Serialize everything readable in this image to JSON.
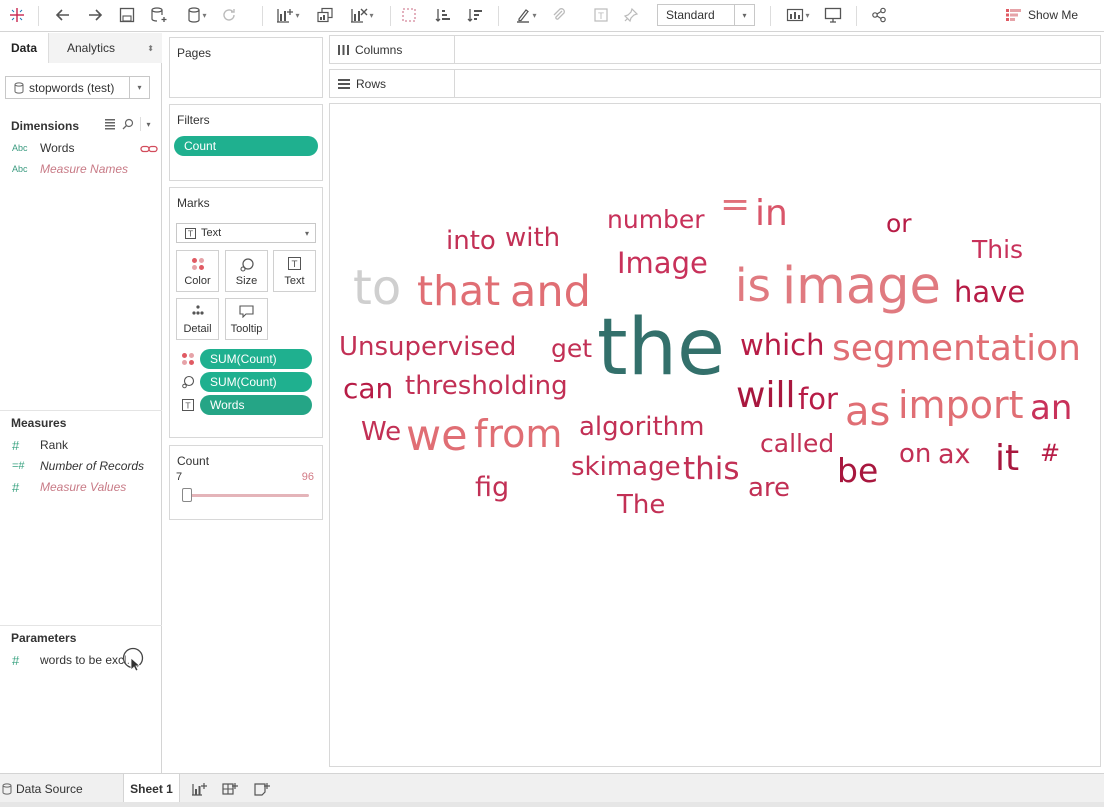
{
  "toolbar": {
    "fit_value": "Standard",
    "show_me_label": "Show Me"
  },
  "data_pane": {
    "tabs": [
      "Data",
      "Analytics"
    ],
    "data_source": "stopwords (test)",
    "dimensions_heading": "Dimensions",
    "dimensions": [
      {
        "type": "Abc",
        "label": "Words"
      },
      {
        "type": "Abc",
        "label": "Measure Names"
      }
    ],
    "measures_heading": "Measures",
    "measures": [
      {
        "type": "#",
        "label": "Rank"
      },
      {
        "type": "=#",
        "label": "Number of Records"
      },
      {
        "type": "#",
        "label": "Measure Values"
      }
    ],
    "parameters_heading": "Parameters",
    "parameters": [
      {
        "type": "#",
        "label": "words to be excl..."
      }
    ]
  },
  "pages": {
    "title": "Pages"
  },
  "filters": {
    "title": "Filters",
    "items": [
      "Count"
    ]
  },
  "marks": {
    "title": "Marks",
    "mark_type": "Text",
    "buttons": [
      "Color",
      "Size",
      "Text",
      "Detail",
      "Tooltip"
    ],
    "fields": [
      "SUM(Count)",
      "SUM(Count)",
      "Words"
    ]
  },
  "count_filter": {
    "title": "Count",
    "min": "7",
    "max": "96"
  },
  "shelves": {
    "columns": "Columns",
    "rows": "Rows"
  },
  "word_cloud": [
    {
      "text": "the",
      "color": "#33706b"
    },
    {
      "text": "to",
      "color": "#cfcfcf"
    },
    {
      "text": "that",
      "color": "#e06e74"
    },
    {
      "text": "and",
      "color": "#e06e74"
    },
    {
      "text": "is",
      "color": "#e07a80"
    },
    {
      "text": "image",
      "color": "#e07a80"
    },
    {
      "text": "=",
      "color": "#e0707a"
    },
    {
      "text": "in",
      "color": "#d9566a"
    },
    {
      "text": "number",
      "color": "#c8315a"
    },
    {
      "text": "Image",
      "color": "#c8315a"
    },
    {
      "text": "into",
      "color": "#c23055"
    },
    {
      "text": "with",
      "color": "#c23055"
    },
    {
      "text": "or",
      "color": "#b71c46"
    },
    {
      "text": "This",
      "color": "#c8315a"
    },
    {
      "text": "have",
      "color": "#b71c46"
    },
    {
      "text": "Unsupervised",
      "color": "#c23055"
    },
    {
      "text": "get",
      "color": "#c23055"
    },
    {
      "text": "which",
      "color": "#b71c46"
    },
    {
      "text": "segmentation",
      "color": "#e06e74"
    },
    {
      "text": "can",
      "color": "#b71c46"
    },
    {
      "text": "thresholding",
      "color": "#c23055"
    },
    {
      "text": "will",
      "color": "#a8173e"
    },
    {
      "text": "for",
      "color": "#b71c46"
    },
    {
      "text": "as",
      "color": "#e06e74"
    },
    {
      "text": "import",
      "color": "#e06e74"
    },
    {
      "text": "an",
      "color": "#c8315a"
    },
    {
      "text": "We",
      "color": "#c23055"
    },
    {
      "text": "we",
      "color": "#e06e74"
    },
    {
      "text": "from",
      "color": "#e06e74"
    },
    {
      "text": "algorithm",
      "color": "#c23055"
    },
    {
      "text": "called",
      "color": "#c23055"
    },
    {
      "text": "on",
      "color": "#c23055"
    },
    {
      "text": "ax",
      "color": "#c23055"
    },
    {
      "text": "it",
      "color": "#a8173e"
    },
    {
      "text": "#",
      "color": "#b71c46"
    },
    {
      "text": "skimage",
      "color": "#c23055"
    },
    {
      "text": "this",
      "color": "#c23055"
    },
    {
      "text": "be",
      "color": "#a8173e"
    },
    {
      "text": "fig",
      "color": "#c23055"
    },
    {
      "text": "are",
      "color": "#c23055"
    },
    {
      "text": "The",
      "color": "#c23055"
    }
  ],
  "bottom": {
    "data_source_tab": "Data Source",
    "sheet_tab": "Sheet 1"
  }
}
